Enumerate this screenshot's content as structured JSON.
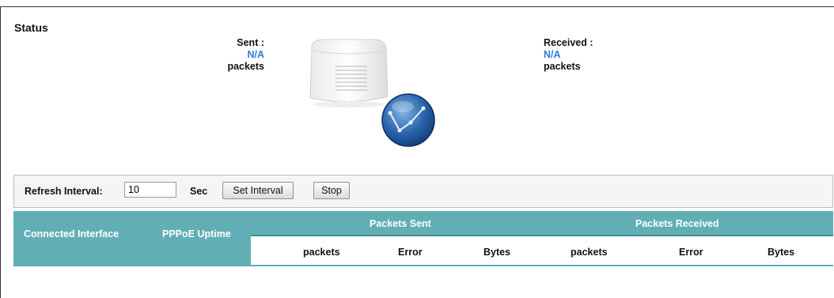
{
  "status": {
    "title": "Status",
    "sent": {
      "label": "Sent :",
      "value": "N/A",
      "unit": "packets"
    },
    "received": {
      "label": "Received :",
      "value": "N/A",
      "unit": "packets"
    }
  },
  "controls": {
    "refresh_label": "Refresh Interval:",
    "refresh_value": "10",
    "sec_label": "Sec",
    "set_interval_button": "Set Interval",
    "stop_button": "Stop"
  },
  "table": {
    "connected_interface": "Connected Interface",
    "pppoe_uptime": "PPPoE Uptime",
    "packets_sent": "Packets Sent",
    "packets_received": "Packets Received",
    "sent_columns": [
      "packets",
      "Error",
      "Bytes"
    ],
    "received_columns": [
      "packets",
      "Error",
      "Bytes"
    ]
  },
  "colors": {
    "accent": "#61aeb4",
    "value_blue": "#2c7cd6"
  },
  "icons": [
    "router-device-icon",
    "globe-icon"
  ]
}
